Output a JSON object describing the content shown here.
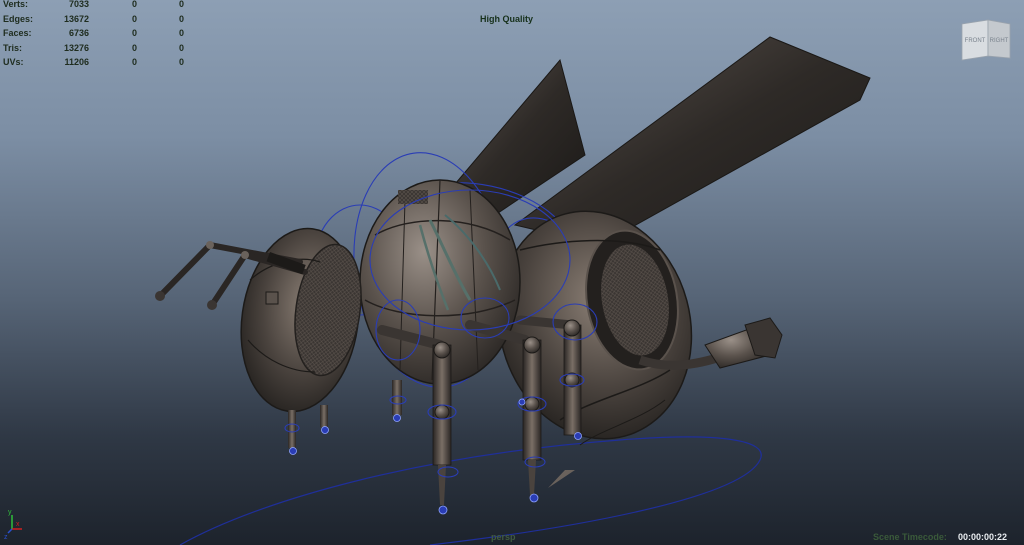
{
  "stats": {
    "rows": [
      {
        "label": "Verts:",
        "value": "7033",
        "sel": "0",
        "comp": "0"
      },
      {
        "label": "Edges:",
        "value": "13672",
        "sel": "0",
        "comp": "0"
      },
      {
        "label": "Faces:",
        "value": "6736",
        "sel": "0",
        "comp": "0"
      },
      {
        "label": "Tris:",
        "value": "13276",
        "sel": "0",
        "comp": "0"
      },
      {
        "label": "UVs:",
        "value": "11206",
        "sel": "0",
        "comp": "0"
      }
    ]
  },
  "viewport": {
    "quality": "High Quality",
    "camera": "persp",
    "timecode_label": "Scene Timecode:",
    "timecode_value": "00:00:00:22"
  },
  "viewcube": {
    "front": "FRONT",
    "right": "RIGHT"
  },
  "axis": {
    "y": "y",
    "x": "x",
    "z": "z"
  },
  "colors": {
    "background_top": "#8d9fb4",
    "background_bottom": "#1d232c",
    "stats_text": "#1e2c1e",
    "hud_text": "#16301a",
    "rig_control": "#2a3db5",
    "metal_dark": "#2a2724",
    "metal_light": "#8a8078",
    "timecode_value": "#e8ecef"
  },
  "model": {
    "name_icon": "robot-bee-model"
  }
}
